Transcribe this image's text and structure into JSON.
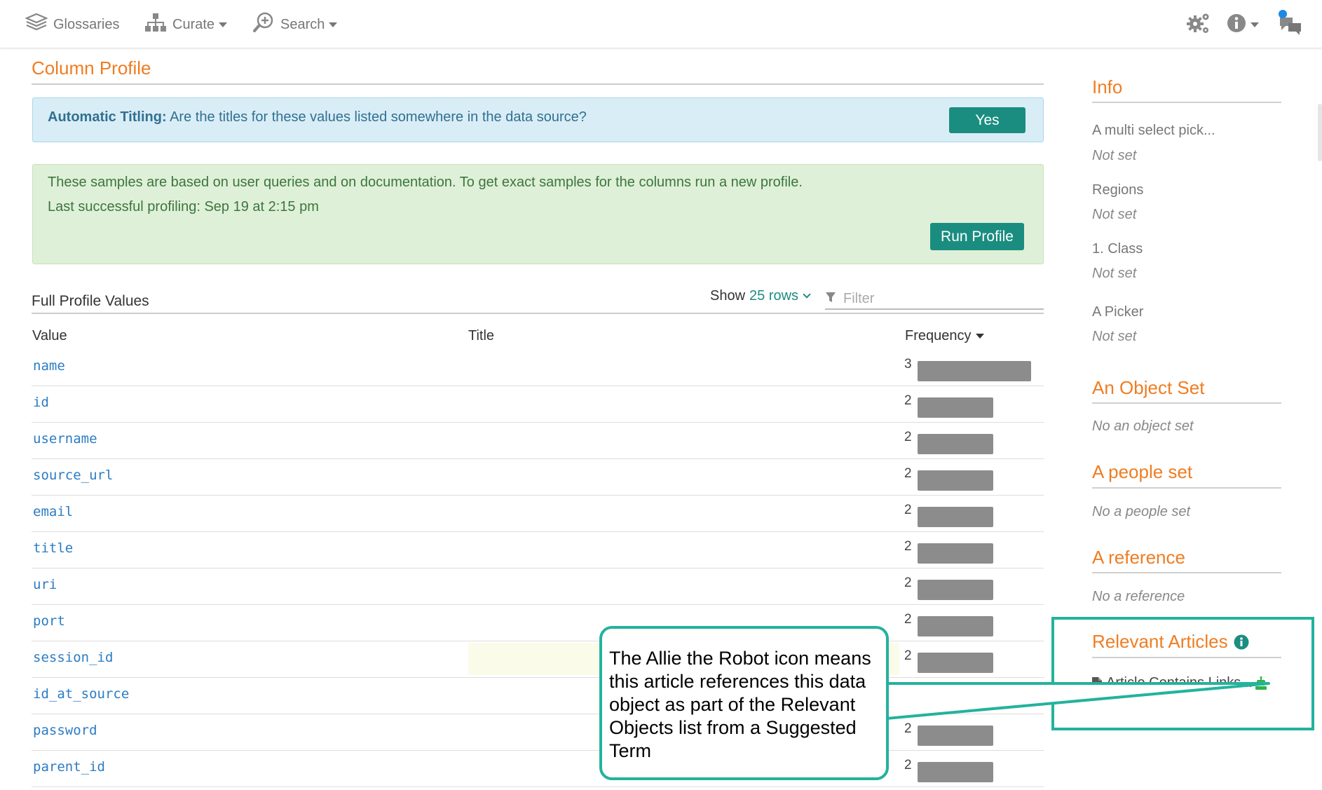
{
  "nav": {
    "glossaries": "Glossaries",
    "curate": "Curate",
    "search": "Search",
    "icons": [
      "book-stack-icon",
      "hierarchy-icon",
      "magnify-plus-icon",
      "gears-icon",
      "info-circle-icon",
      "chat-bubbles-icon"
    ]
  },
  "header": {
    "title": "Column Profile"
  },
  "auto_titling": {
    "label": "Automatic Titling:",
    "question": "Are the titles for these values listed somewhere in the data source?",
    "button": "Yes"
  },
  "profile_notice": {
    "line1": "These samples are based on user queries and on documentation. To get exact samples for the columns run a new profile.",
    "line2": "Last successful profiling: Sep 19 at 2:15 pm",
    "button": "Run Profile"
  },
  "table": {
    "section_title": "Full Profile Values",
    "show_label": "Show",
    "rows_option": "25 rows",
    "filter_placeholder": "Filter",
    "columns": {
      "value": "Value",
      "title": "Title",
      "frequency": "Frequency"
    },
    "rows": [
      {
        "value": "name",
        "frequency": "3",
        "bar_fraction": 1.0
      },
      {
        "value": "id",
        "frequency": "2",
        "bar_fraction": 0.667
      },
      {
        "value": "username",
        "frequency": "2",
        "bar_fraction": 0.667
      },
      {
        "value": "source_url",
        "frequency": "2",
        "bar_fraction": 0.667
      },
      {
        "value": "email",
        "frequency": "2",
        "bar_fraction": 0.667
      },
      {
        "value": "title",
        "frequency": "2",
        "bar_fraction": 0.667
      },
      {
        "value": "uri",
        "frequency": "2",
        "bar_fraction": 0.667
      },
      {
        "value": "port",
        "frequency": "2",
        "bar_fraction": 0.667
      },
      {
        "value": "session_id",
        "frequency": "2",
        "bar_fraction": 0.667
      },
      {
        "value": "id_at_source",
        "frequency": "",
        "bar_fraction": 0
      },
      {
        "value": "password",
        "frequency": "2",
        "bar_fraction": 0.667
      },
      {
        "value": "parent_id",
        "frequency": "2",
        "bar_fraction": 0.667
      }
    ]
  },
  "sidebar": {
    "info_title": "Info",
    "fields": [
      {
        "label": "A multi select pick...",
        "value": "Not set"
      },
      {
        "label": "Regions",
        "value": "Not set"
      },
      {
        "label": "1. Class",
        "value": "Not set"
      },
      {
        "label": "A Picker",
        "value": "Not set"
      }
    ],
    "object_set": {
      "title": "An Object Set",
      "value": "No an object set"
    },
    "people_set": {
      "title": "A people set",
      "value": "No a people set"
    },
    "reference": {
      "title": "A reference",
      "value": "No a reference"
    },
    "articles": {
      "title": "Relevant Articles",
      "item": "Article Contains Links..."
    }
  },
  "callout": {
    "text": "The Allie the Robot icon means this article references this data object as part of the Relevant Objects list from a Suggested Term"
  },
  "colors": {
    "accent_orange": "#ef7d22",
    "teal": "#1a8d80",
    "callout_teal": "#24b29e",
    "link_blue": "#2b7cc4",
    "robot_green": "#2fb34a"
  }
}
